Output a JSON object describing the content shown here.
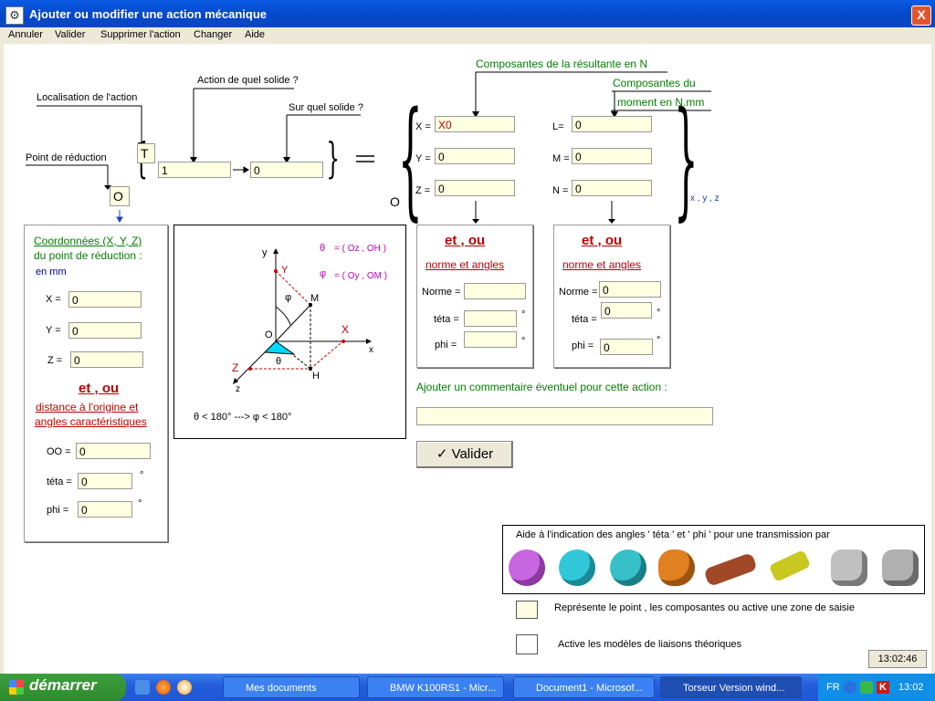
{
  "window": {
    "title": "Ajouter ou modifier une action mécanique",
    "close": "X"
  },
  "menu": [
    "Annuler",
    "Valider",
    "Supprimer l'action",
    "Changer",
    "Aide"
  ],
  "torseur": {
    "localisation_label": "Localisation de l'action",
    "action_label": "Action de quel solide ?",
    "sur_label": "Sur quel solide ?",
    "point_label": "Point de réduction",
    "point_letter": "T",
    "solide_from": "1",
    "solide_to": "0",
    "point_origin": "O",
    "equals": "=",
    "origin_small": "O",
    "basis": "x , y , z"
  },
  "resultante": {
    "title": "Composantes de la résultante en N",
    "X_label": "X =",
    "X": "X0",
    "Y_label": "Y =",
    "Y": "0",
    "Z_label": "Z =",
    "Z": "0"
  },
  "moment": {
    "title1": "Composantes du",
    "title2": "moment en N.mm",
    "L_label": "L=",
    "L": "0",
    "M_label": "M =",
    "M": "0",
    "N_label": "N =",
    "N": "0"
  },
  "coords": {
    "title": "Coordonnées (X, Y, Z)",
    "subtitle": "du point de réduction :",
    "unit": "en mm",
    "X_label": "X =",
    "X": "0",
    "Y_label": "Y =",
    "Y": "0",
    "Z_label": "Z =",
    "Z": "0",
    "etou": "et , ou",
    "dist1": "distance à l'origine et",
    "dist2": "angles caractéristiques",
    "OO_label": "OO =",
    "OO": "0",
    "teta_label": "téta =",
    "teta": "0",
    "phi_label": "phi  =",
    "phi": "0",
    "deg": "°"
  },
  "diagram": {
    "theta_def": "= ( Oz , OH )",
    "phi_def": "= ( Oy , OM )",
    "range": "θ  < 180°  --->  φ   < 180°",
    "theta": "θ",
    "phi": "φ",
    "y": "y",
    "x": "x",
    "z": "z",
    "O": "O",
    "M": "M",
    "H": "H",
    "Y": "Y",
    "X": "X",
    "Z": "Z"
  },
  "res_norm": {
    "etou": "et , ou",
    "title": "norme et angles",
    "norme_label": "Norme =",
    "norme": "",
    "teta_label": "téta =",
    "teta": "",
    "phi_label": "phi  =",
    "phi": "",
    "deg": "°"
  },
  "mom_norm": {
    "etou": "et , ou",
    "title": "norme et angles",
    "norme_label": "Norme =",
    "norme": "0",
    "teta_label": "téta =",
    "teta": "0",
    "phi_label": "phi  =",
    "phi": "0",
    "deg": "°"
  },
  "comment": {
    "label": "Ajouter un commentaire éventuel pour cette action :",
    "value": ""
  },
  "valider": "Valider",
  "aide": {
    "title": "Aide à l'indication des angles ' téta ' et ' phi ' pour une transmission par",
    "gears": [
      "#c865e0",
      "#30c8d8",
      "#38c0c8",
      "#e08020",
      "#a04828",
      "#c8c820",
      "#c0c0c0",
      "#b0b0b0"
    ]
  },
  "legend1": "Représente le point , les composantes ou active une zone de saisie",
  "legend2": "Active les modèles de liaisons théoriques",
  "clock": "13:02:46",
  "taskbar": {
    "start": "démarrer",
    "tasks": [
      "Mes documents",
      "BMW K100RS1 - Micr...",
      "Document1 - Microsof...",
      "Torseur Version wind..."
    ],
    "lang": "FR",
    "time": "13:02"
  }
}
